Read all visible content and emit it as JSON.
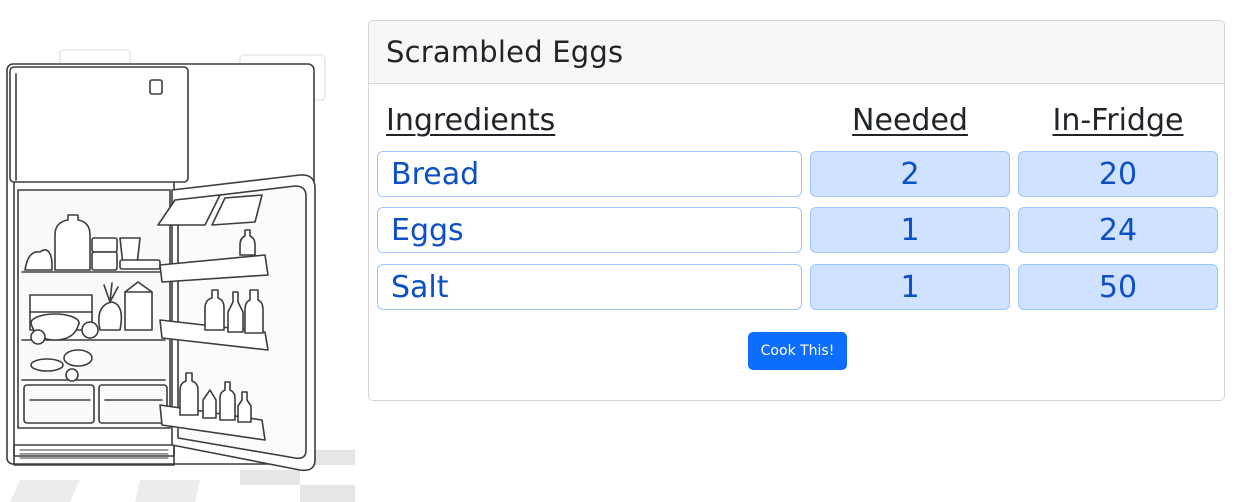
{
  "recipe": {
    "title": "Scrambled Eggs",
    "headers": {
      "ingredients": "Ingredients",
      "needed": "Needed",
      "in_fridge": "In-Fridge"
    },
    "rows": [
      {
        "name": "Bread",
        "needed": "2",
        "in_fridge": "20"
      },
      {
        "name": "Eggs",
        "needed": "1",
        "in_fridge": "24"
      },
      {
        "name": "Salt",
        "needed": "1",
        "in_fridge": "50"
      }
    ],
    "cook_label": "Cook This!"
  },
  "colors": {
    "accent": "#0d6efd",
    "value_text": "#0d4fc4",
    "value_bg": "#cfe2ff",
    "value_border": "#9ec5fe"
  },
  "illustration": {
    "icon": "open-fridge-illustration"
  }
}
